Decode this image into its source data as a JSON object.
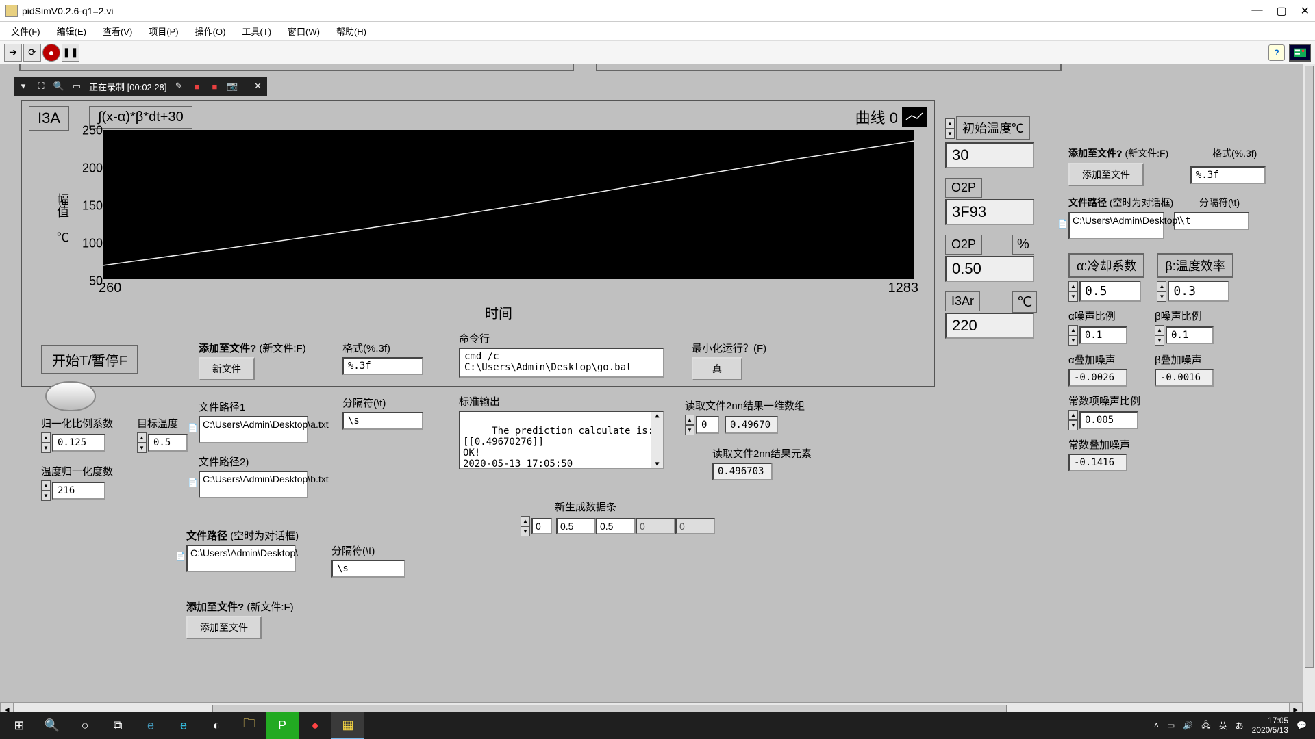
{
  "window": {
    "title": "pidSimV0.2.6-q1=2.vi",
    "minimize": "—",
    "maximize": "▢",
    "close": "✕"
  },
  "menus": [
    "文件(F)",
    "编辑(E)",
    "查看(V)",
    "项目(P)",
    "操作(O)",
    "工具(T)",
    "窗口(W)",
    "帮助(H)"
  ],
  "recbar": {
    "status": "正在录制",
    "time": "[00:02:28]"
  },
  "chart": {
    "i3a": "I3A",
    "formula": "∫(x-α)*β*dt+30",
    "legend": "曲线 0",
    "ylabel": "幅值 ℃",
    "xlabel": "时间",
    "yticks": [
      "250",
      "200",
      "150",
      "100",
      "50"
    ],
    "xticks": {
      "min": "260",
      "max": "1283"
    }
  },
  "chart_data": {
    "type": "line",
    "title": "∫(x-α)*β*dt+30",
    "xlabel": "时间",
    "ylabel": "幅值 ℃",
    "xlim": [
      260,
      1283
    ],
    "ylim": [
      50,
      250
    ],
    "series": [
      {
        "name": "曲线 0",
        "x": [
          260,
          400,
          550,
          700,
          850,
          1000,
          1150,
          1283
        ],
        "y": [
          68,
          88,
          108,
          132,
          158,
          182,
          208,
          232
        ]
      }
    ]
  },
  "indicators": {
    "init_temp_label": "初始温度℃",
    "init_temp": "30",
    "o2p_label": "O2P",
    "o2p_hex": "3F93",
    "o2p_pct_label": "O2P",
    "o2p_pct_unit": "%",
    "o2p_pct": "0.50",
    "i3ar_label": "I3Ar",
    "i3ar_unit": "℃",
    "i3ar": "220"
  },
  "run_toggle": "开始T/暂停F",
  "norm_k_label": "归一化比例系数",
  "norm_k": "0.125",
  "target_t_label": "目标温度",
  "target_t": "0.5",
  "norm_deg_label": "温度归一化度数",
  "norm_deg": "216",
  "addfile": {
    "label": "添加至文件?",
    "hint": "(新文件:F)",
    "btn": "新文件"
  },
  "addfile2": {
    "label": "添加至文件?",
    "hint": "(新文件:F)",
    "btn": "添加至文件"
  },
  "path1": {
    "label": "文件路径1",
    "value": "C:\\Users\\Admin\\Desktop\\a.txt"
  },
  "path2": {
    "label": "文件路径2)",
    "value": "C:\\Users\\Admin\\Desktop\\b.txt"
  },
  "path3": {
    "label": "文件路径",
    "hint": "(空时为对话框)",
    "value": "C:\\Users\\Admin\\Desktop\\"
  },
  "fmt": {
    "label": "格式(%.3f)",
    "value": "%.3f"
  },
  "sep": {
    "label": "分隔符(\\t)",
    "value": "\\s"
  },
  "sep2": {
    "label": "分隔符(\\t)",
    "value": "\\s"
  },
  "cmd": {
    "label": "命令行",
    "value": "cmd /c C:\\Users\\Admin\\Desktop\\go.bat"
  },
  "stdout": {
    "label": "标准输出",
    "value": "The prediction calculate is:\n[[0.49670276]]\nOK!\n2020-05-13 17:05:50"
  },
  "minrun": {
    "label": "最小化运行？(F)",
    "value": "真"
  },
  "read1d": {
    "label": "读取文件2nn结果一维数组",
    "idx": "0",
    "val": "0.49670"
  },
  "read_elem": {
    "label": "读取文件2nn结果元素",
    "val": "0.496703"
  },
  "newdata": {
    "label": "新生成数据条",
    "idx": "0",
    "v1": "0.5",
    "v2": "0.5",
    "v3": "0",
    "v4": "0"
  },
  "right": {
    "addfile_label": "添加至文件?",
    "addfile_hint": "(新文件:F)",
    "addfile_btn": "添加至文件",
    "fmt_label": "格式(%.3f)",
    "fmt": "%.3f",
    "path_label": "文件路径",
    "path_hint": "(空时为对话框)",
    "path": "C:\\Users\\Admin\\Desktop\\",
    "sep_label": "分隔符(\\t)",
    "sep": "\\t",
    "alpha_label": "α:冷却系数",
    "alpha": "0.5",
    "beta_label": "β:温度效率",
    "beta": "0.3",
    "a_noise_r_label": "α噪声比例",
    "a_noise_r": "0.1",
    "b_noise_r_label": "β噪声比例",
    "b_noise_r": "0.1",
    "a_add_label": "α叠加噪声",
    "a_add": "-0.0026",
    "b_add_label": "β叠加噪声",
    "b_add": "-0.0016",
    "const_r_label": "常数项噪声比例",
    "const_r": "0.005",
    "const_add_label": "常数叠加噪声",
    "const_add": "-0.1416"
  },
  "tray": {
    "time": "17:05",
    "date": "2020/5/13",
    "ime": "英",
    "kana": "あ"
  }
}
